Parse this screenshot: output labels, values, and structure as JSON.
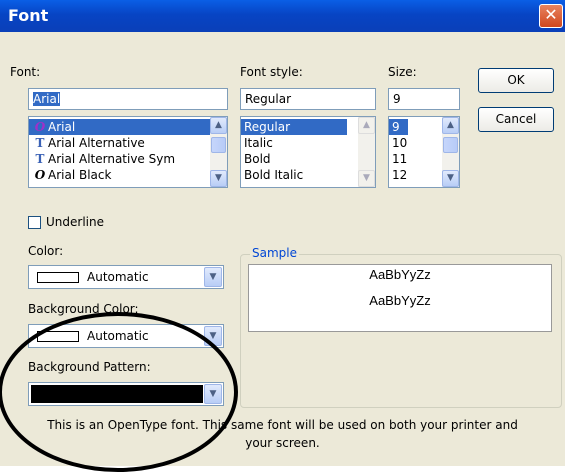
{
  "window": {
    "title": "Font",
    "close_glyph": "✕"
  },
  "font": {
    "label": "Font:",
    "value": "Arial",
    "items": [
      {
        "label": "Arial",
        "icon": "opentype-icon",
        "selected": true
      },
      {
        "label": "Arial Alternative",
        "icon": "truetype-icon"
      },
      {
        "label": "Arial Alternative Sym",
        "icon": "truetype-icon"
      },
      {
        "label": "Arial Black",
        "icon": "opentype-icon"
      }
    ]
  },
  "font_style": {
    "label": "Font style:",
    "value": "Regular",
    "items": [
      {
        "label": "Regular",
        "selected": true
      },
      {
        "label": "Italic"
      },
      {
        "label": "Bold"
      },
      {
        "label": "Bold Italic"
      }
    ]
  },
  "size": {
    "label": "Size:",
    "value": "9",
    "items": [
      {
        "label": "9",
        "selected": true
      },
      {
        "label": "10"
      },
      {
        "label": "11"
      },
      {
        "label": "12"
      }
    ]
  },
  "buttons": {
    "ok": "OK",
    "cancel": "Cancel"
  },
  "underline": {
    "label": "Underline",
    "checked": false
  },
  "color": {
    "label": "Color:",
    "value": "Automatic"
  },
  "background_color": {
    "label": "Background Color:",
    "value": "Automatic"
  },
  "background_pattern": {
    "label": "Background Pattern:",
    "swatch_color": "#000000"
  },
  "sample": {
    "caption": "Sample",
    "line1": "AaBbYyZz",
    "line2": "AaBbYyZz"
  },
  "note": {
    "line1": "This is an OpenType font. This same font will be used on both your printer and",
    "line2": "your screen."
  },
  "colors": {
    "accent": "#316ac5",
    "titlebar": "#0a5fe6",
    "dialog_bg": "#ece9d8",
    "close_button": "#d2471d"
  }
}
